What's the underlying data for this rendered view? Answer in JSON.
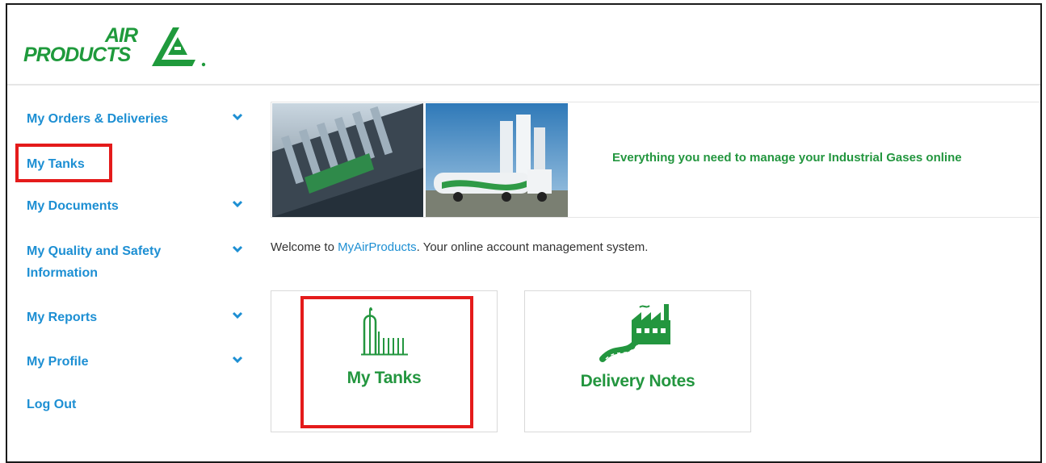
{
  "header": {
    "logo_top": "AIR",
    "logo_bottom": "PRODUCTS"
  },
  "sidebar": {
    "items": [
      {
        "label": "My Orders & Deliveries",
        "has_chevron": true
      },
      {
        "label": "My Tanks",
        "has_chevron": false,
        "highlighted": true
      },
      {
        "label": "My Documents",
        "has_chevron": true
      },
      {
        "label": "My Quality and Safety Information",
        "has_chevron": true
      },
      {
        "label": "My Reports",
        "has_chevron": true
      },
      {
        "label": "My Profile",
        "has_chevron": true
      },
      {
        "label": "Log Out",
        "has_chevron": false
      }
    ]
  },
  "banner": {
    "tagline": "Everything you need to manage your Industrial Gases online"
  },
  "welcome": {
    "prefix": "Welcome to ",
    "brand": "MyAirProducts",
    "suffix": ". Your online account management system."
  },
  "tiles": [
    {
      "label": "My Tanks",
      "icon": "tank-icon",
      "highlighted": true
    },
    {
      "label": "Delivery Notes",
      "icon": "delivery-truck-factory-icon",
      "highlighted": false
    }
  ],
  "colors": {
    "brand_green": "#23963f",
    "link_blue": "#1d8fd3",
    "highlight_red": "#e41b1b"
  }
}
